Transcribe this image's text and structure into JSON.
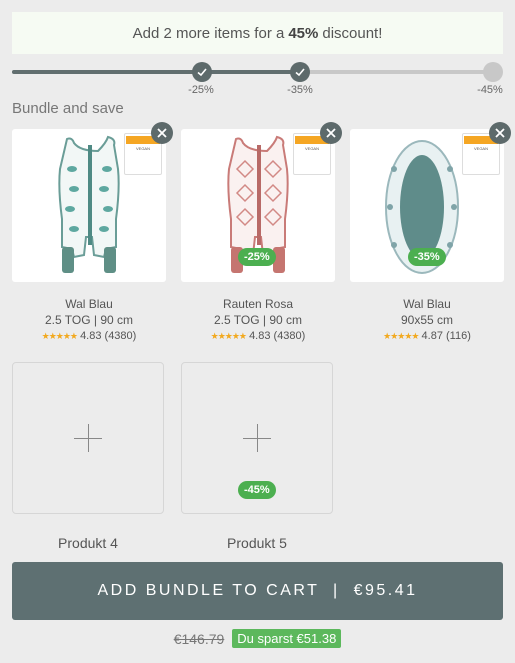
{
  "banner": {
    "prefix": "Add 2 more items for a",
    "discount": "45%",
    "suffix": "discount!"
  },
  "progress": {
    "fill_fraction": 0.6,
    "steps": [
      {
        "label": "-25%",
        "reached": true
      },
      {
        "label": "-35%",
        "reached": true
      },
      {
        "label": "-45%",
        "reached": false
      }
    ]
  },
  "section_title": "Bundle and save",
  "products": [
    {
      "name": "Wal Blau",
      "variant": "2.5 TOG | 90 cm",
      "stars": "★★★★★",
      "rating": "4.83 (4380)",
      "badge": ""
    },
    {
      "name": "Rauten Rosa",
      "variant": "2.5 TOG | 90 cm",
      "stars": "★★★★★",
      "rating": "4.83 (4380)",
      "badge": "-25%"
    },
    {
      "name": "Wal Blau",
      "variant": "90x55 cm",
      "stars": "★★★★★",
      "rating": "4.87 (116)",
      "badge": "-35%"
    }
  ],
  "empty_slots": [
    {
      "label": "Produkt 4",
      "badge": ""
    },
    {
      "label": "Produkt 5",
      "badge": "-45%"
    }
  ],
  "cta": {
    "label": "ADD BUNDLE TO CART  |  €95.41"
  },
  "pricing": {
    "old_price": "€146.79",
    "savings": "Du sparst €51.38"
  },
  "colors": {
    "accent_dark": "#5e7072",
    "success": "#4caf50",
    "star": "#f2a91f"
  }
}
